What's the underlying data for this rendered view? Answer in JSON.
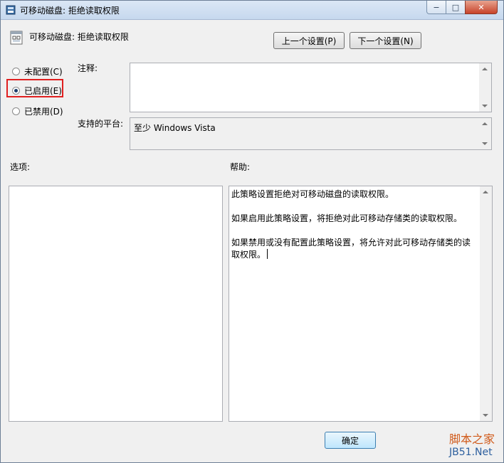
{
  "window": {
    "title": "可移动磁盘: 拒绝读取权限",
    "controls": {
      "minimize": "−",
      "maximize": "□",
      "close": "✕"
    }
  },
  "policy": {
    "title": "可移动磁盘: 拒绝读取权限"
  },
  "nav": {
    "prev_label": "上一个设置(P)",
    "next_label": "下一个设置(N)"
  },
  "state": {
    "options": [
      {
        "label": "未配置(C)",
        "checked": false
      },
      {
        "label": "已启用(E)",
        "checked": true
      },
      {
        "label": "已禁用(D)",
        "checked": false
      }
    ]
  },
  "labels": {
    "comment": "注释:",
    "platform": "支持的平台:",
    "options": "选项:",
    "help": "帮助:"
  },
  "comment_value": "",
  "platform_value": "至少 Windows Vista",
  "help": {
    "paragraphs": [
      "此策略设置拒绝对可移动磁盘的读取权限。",
      "如果启用此策略设置，将拒绝对此可移动存储类的读取权限。",
      "如果禁用或没有配置此策略设置，将允许对此可移动存储类的读取权限。"
    ]
  },
  "footer": {
    "ok_label": "确定"
  },
  "watermark": {
    "line1": "脚本之家",
    "line2": "JB51.Net"
  }
}
